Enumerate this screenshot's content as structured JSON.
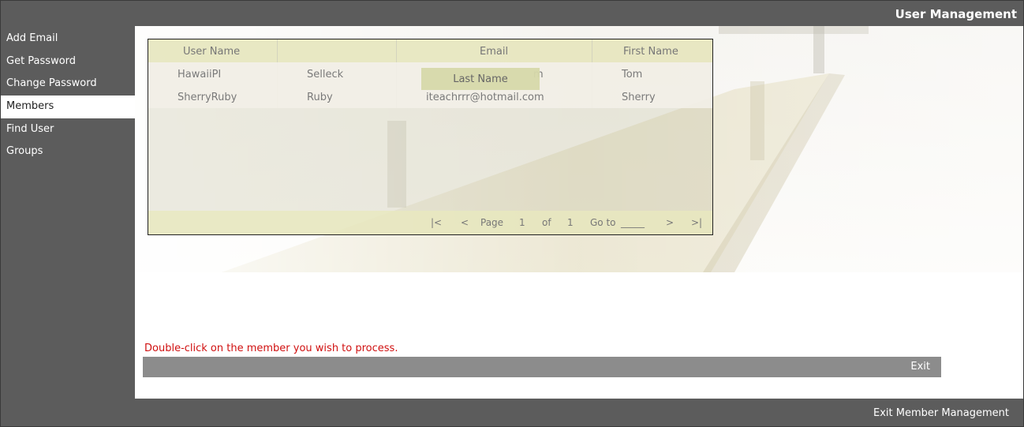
{
  "header": {
    "title": "User Management"
  },
  "sidebar": {
    "items": [
      {
        "label": "Add Email"
      },
      {
        "label": "Get Password"
      },
      {
        "label": "Change Password"
      },
      {
        "label": "Members",
        "active": true
      },
      {
        "label": "Find User"
      },
      {
        "label": "Groups"
      }
    ]
  },
  "grid": {
    "columns": [
      "User Name",
      "Email",
      "First Name"
    ],
    "drag_column_label": "Last Name",
    "rows": [
      {
        "user_name": "HawaiiPI",
        "last_name": "Selleck",
        "email": "m",
        "first_name": "Tom"
      },
      {
        "user_name": "SherryRuby",
        "last_name": "Ruby",
        "email": "iteachrrr@hotmail.com",
        "first_name": "Sherry"
      }
    ],
    "pager": {
      "first": "|<",
      "prev": "<",
      "page_label": "Page",
      "page": "1",
      "of_label": "of",
      "total": "1",
      "goto_label": "Go to",
      "goto_blank": "_____",
      "next": ">",
      "last": ">|"
    }
  },
  "hint": "Double-click on the member you wish to process.",
  "actions": {
    "exit_label": "Exit"
  },
  "footer": {
    "exit_member_management": "Exit Member Management"
  },
  "colors": {
    "chrome": "#5c5c5c",
    "hint": "#d01010",
    "exitbar": "#8c8c8c",
    "grid_header": "#e8e8be"
  }
}
